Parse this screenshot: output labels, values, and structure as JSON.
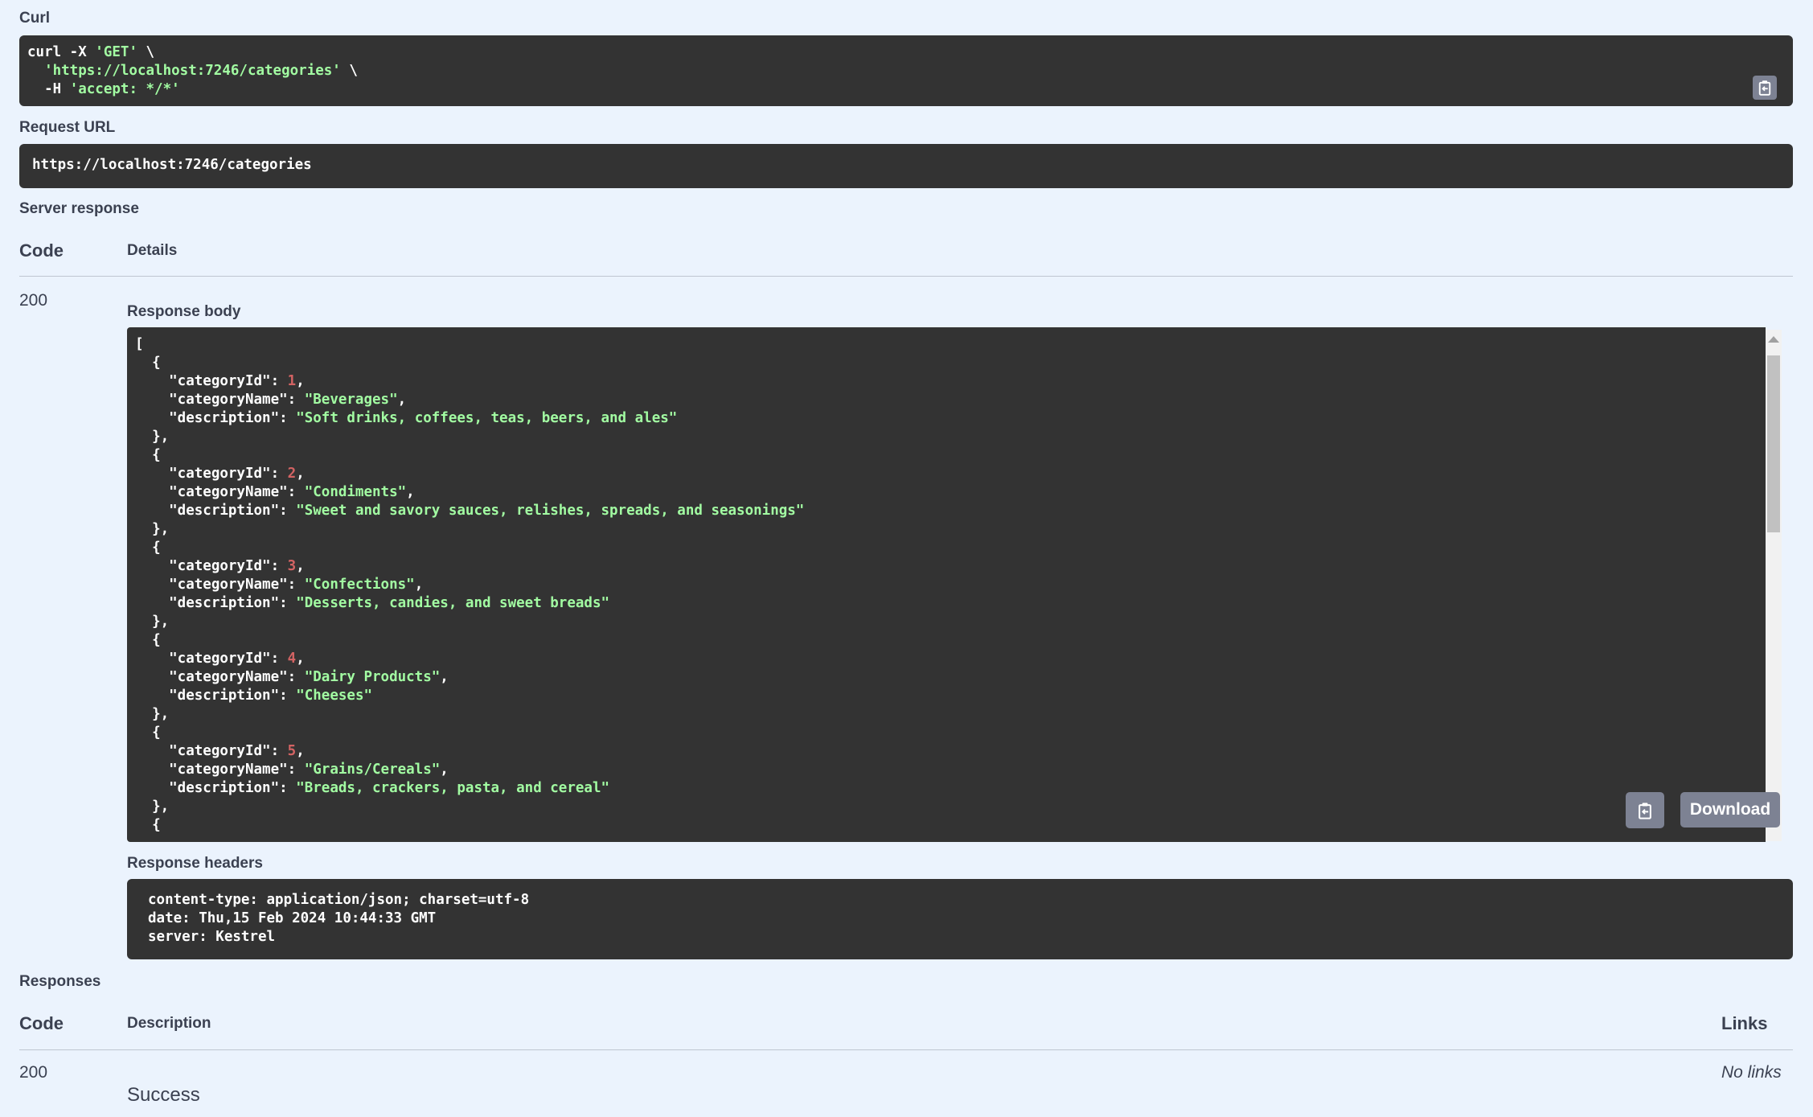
{
  "curl": {
    "label": "Curl",
    "line1_prefix": "curl -X ",
    "line1_method": "'GET'",
    "line1_suffix": " \\",
    "line2_url": "'https://localhost:7246/categories'",
    "line2_suffix": " \\",
    "line3_prefix": "-H ",
    "line3_header": "'accept: */*'"
  },
  "request_url": {
    "label": "Request URL",
    "value": "https://localhost:7246/categories"
  },
  "server_response": {
    "label": "Server response",
    "col_code": "Code",
    "col_details": "Details",
    "code": "200",
    "body_label": "Response body",
    "download_label": "Download",
    "headers_label": "Response headers",
    "headers": [
      "content-type: application/json; charset=utf-8",
      "date: Thu,15 Feb 2024 10:44:33 GMT",
      "server: Kestrel"
    ]
  },
  "response_body": [
    {
      "categoryId": "1",
      "categoryName": "\"Beverages\"",
      "description": "\"Soft drinks, coffees, teas, beers, and ales\""
    },
    {
      "categoryId": "2",
      "categoryName": "\"Condiments\"",
      "description": "\"Sweet and savory sauces, relishes, spreads, and seasonings\""
    },
    {
      "categoryId": "3",
      "categoryName": "\"Confections\"",
      "description": "\"Desserts, candies, and sweet breads\""
    },
    {
      "categoryId": "4",
      "categoryName": "\"Dairy Products\"",
      "description": "\"Cheeses\""
    },
    {
      "categoryId": "5",
      "categoryName": "\"Grains/Cereals\"",
      "description": "\"Breads, crackers, pasta, and cereal\""
    }
  ],
  "json_keys": {
    "id": "\"categoryId\"",
    "name": "\"categoryName\"",
    "desc": "\"description\""
  },
  "responses": {
    "label": "Responses",
    "col_code": "Code",
    "col_description": "Description",
    "col_links": "Links",
    "code": "200",
    "description": "Success",
    "links": "No links"
  },
  "icons": {
    "copy": "clipboard-icon"
  },
  "colors": {
    "background": "#ebf3fd",
    "code_bg": "#333333",
    "string": "#a2fca2",
    "number": "#d36363"
  }
}
